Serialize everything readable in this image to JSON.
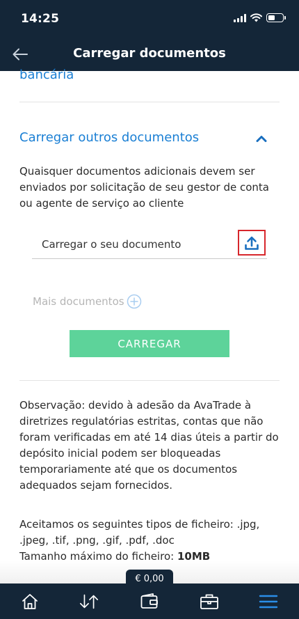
{
  "status_bar": {
    "time": "14:25"
  },
  "header": {
    "title": "Carregar documentos"
  },
  "previous_section": {
    "title_fragment": "bancária"
  },
  "section": {
    "title": "Carregar outros documentos",
    "description": "Quaisquer documentos adicionais devem ser enviados por solicitação de seu gestor de conta ou agente de serviço ao cliente"
  },
  "upload": {
    "placeholder": "Carregar o seu documento"
  },
  "more_documents": {
    "label": "Mais documentos"
  },
  "submit": {
    "label": "CARREGAR"
  },
  "note": "Observação: devido à adesão da AvaTrade à diretrizes regulatórias estritas, contas que não foram verificadas em até 14 dias úteis a partir do depósito inicial podem ser bloqueadas temporariamente até que os documentos adequados sejam fornecidos.",
  "file_types": {
    "accepted": "Aceitamos os seguintes tipos de ficheiro: .jpg, .jpeg, .tif, .png, .gif, .pdf, .doc",
    "max_size_label": "Tamanho máximo do ficheiro:",
    "max_size_value": "10MB"
  },
  "balance": {
    "amount": "€ 0,00"
  },
  "bottom_nav": {
    "items": [
      {
        "icon": "home-icon"
      },
      {
        "icon": "transfer-icon"
      },
      {
        "icon": "wallet-icon"
      },
      {
        "icon": "briefcase-icon"
      },
      {
        "icon": "menu-icon"
      }
    ]
  },
  "colors": {
    "header_bg": "#142638",
    "link_blue": "#1a7fd4",
    "button_green": "#5dd39a",
    "highlight_red": "#d7262b"
  }
}
